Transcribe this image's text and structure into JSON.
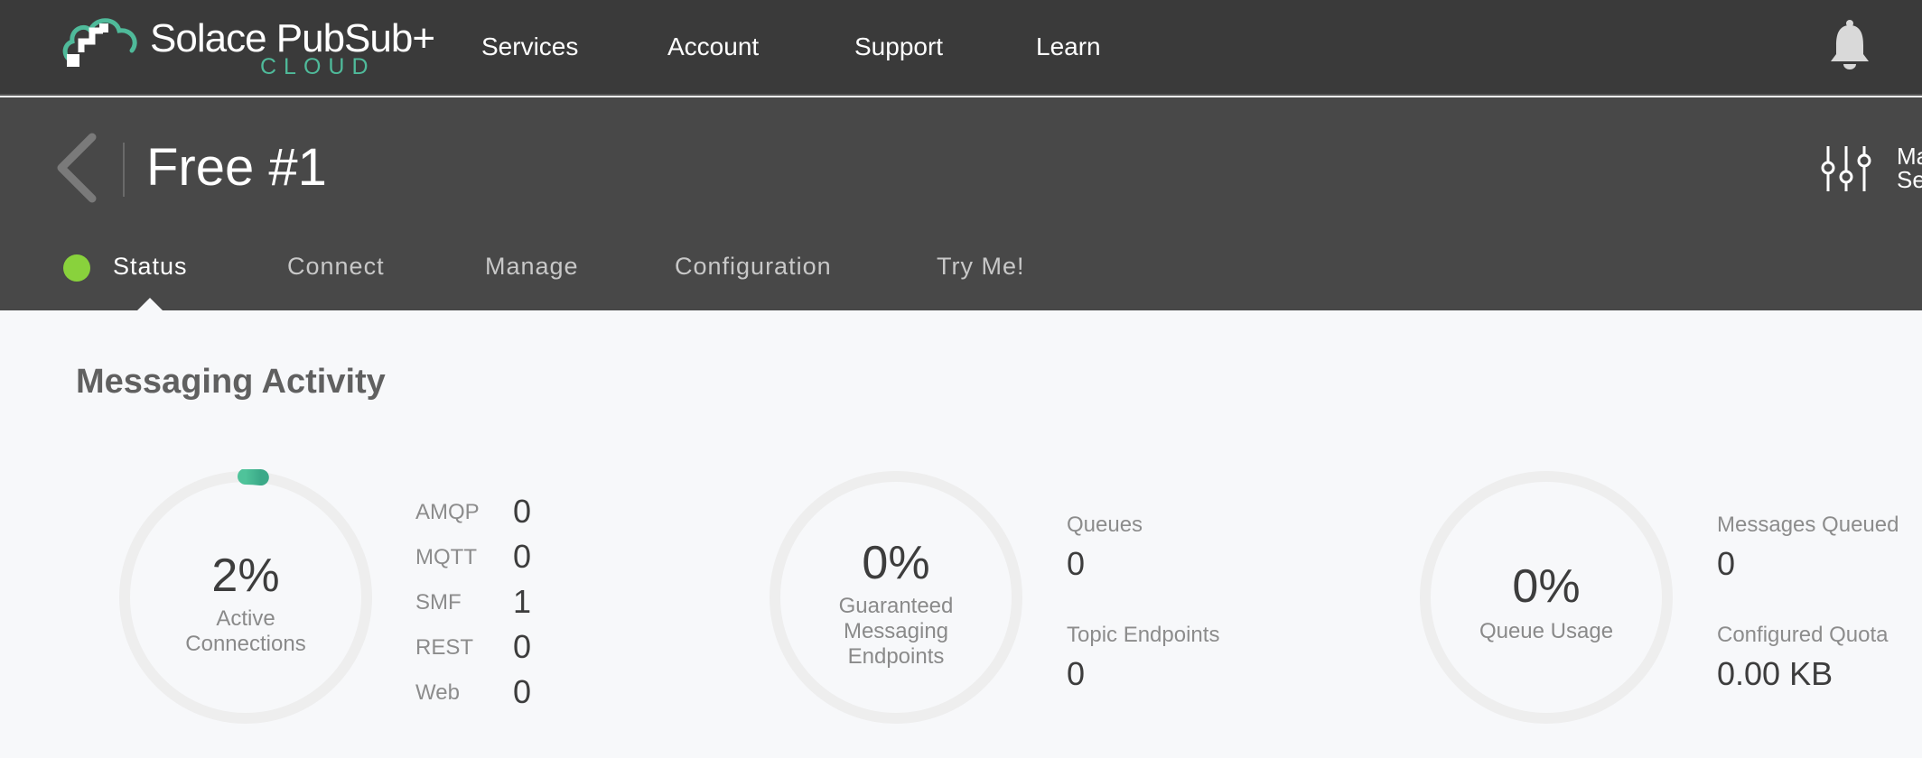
{
  "topbar": {
    "logo": {
      "name": "Solace PubSub+",
      "sub": "CLOUD"
    },
    "nav": [
      "Services",
      "Account",
      "Support",
      "Learn"
    ]
  },
  "service": {
    "title": "Free #1",
    "settings_label_line1": "Ma",
    "settings_label_line2": "Se",
    "tabs": [
      "Status",
      "Connect",
      "Manage",
      "Configuration",
      "Try Me!"
    ],
    "active_tab": "Status",
    "status_color": "#89d23c"
  },
  "messaging_activity": {
    "title": "Messaging Activity",
    "connections": {
      "percent": 0.02,
      "value": "2%",
      "label_line1": "Active",
      "label_line2": "Connections",
      "protocols": [
        {
          "name": "AMQP",
          "value": "0"
        },
        {
          "name": "MQTT",
          "value": "0"
        },
        {
          "name": "SMF",
          "value": "1"
        },
        {
          "name": "REST",
          "value": "0"
        },
        {
          "name": "Web",
          "value": "0"
        }
      ]
    },
    "endpoints": {
      "percent": 0,
      "value": "0%",
      "label_line1": "Guaranteed",
      "label_line2": "Messaging",
      "label_line3": "Endpoints",
      "queues_label": "Queues",
      "queues_value": "0",
      "topic_endpoints_label": "Topic Endpoints",
      "topic_endpoints_value": "0"
    },
    "queue_usage": {
      "percent": 0,
      "value": "0%",
      "label": "Queue Usage",
      "messages_queued_label": "Messages Queued",
      "messages_queued_value": "0",
      "configured_quota_label": "Configured Quota",
      "configured_quota_value": "0.00 KB"
    }
  },
  "colors": {
    "topbar": "#3a3a3a",
    "header": "#484848",
    "accent": "#4fba9a",
    "gauge_track": "#eeeeee"
  }
}
